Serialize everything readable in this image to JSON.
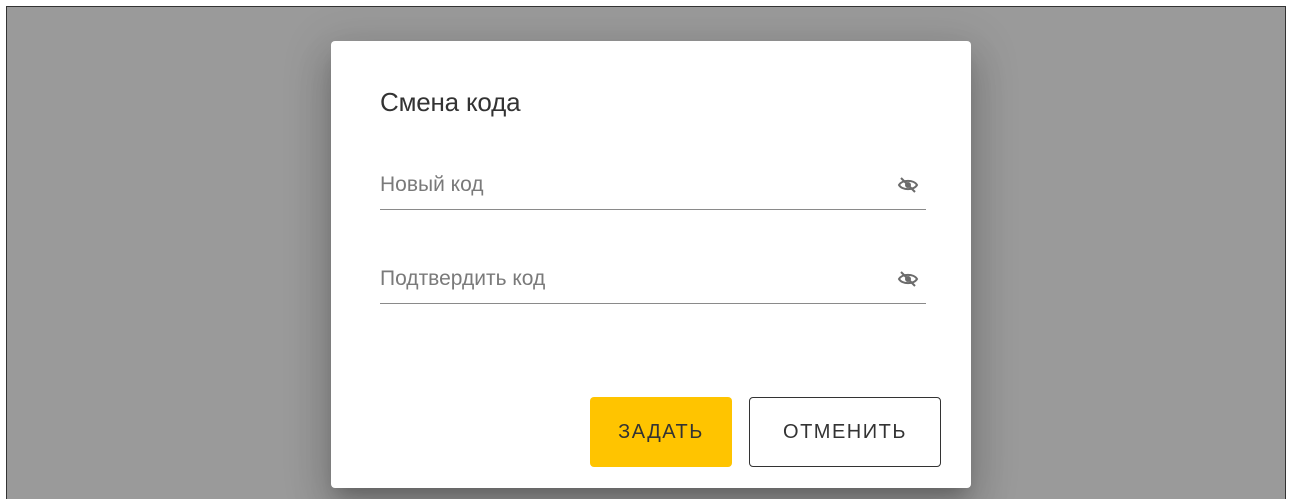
{
  "dialog": {
    "title": "Смена кода",
    "fields": [
      {
        "placeholder": "Новый код",
        "value": "",
        "visibility_icon": "eye-off-icon"
      },
      {
        "placeholder": "Подтвердить код",
        "value": "",
        "visibility_icon": "eye-off-icon"
      }
    ],
    "buttons": {
      "confirm_label": "ЗАДАТЬ",
      "cancel_label": "ОТМЕНИТЬ"
    }
  },
  "colors": {
    "backdrop": "#9a9a9a",
    "dialog_bg": "#ffffff",
    "primary_button": "#ffc400",
    "text": "#333333"
  }
}
